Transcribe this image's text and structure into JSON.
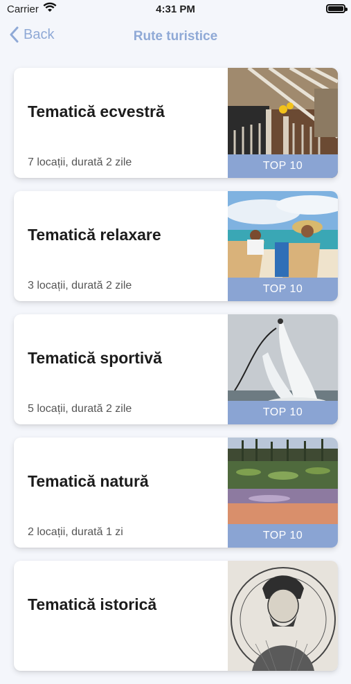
{
  "status": {
    "carrier": "Carrier",
    "time": "4:31 PM"
  },
  "nav": {
    "back_label": "Back",
    "title": "Rute turistice"
  },
  "routes": [
    {
      "title": "Tematică ecvestră",
      "subtitle": "7 locații, durată 2 zile",
      "badge": "TOP 10",
      "image": "stable-photo"
    },
    {
      "title": "Tematică relaxare",
      "subtitle": "3 locații, durată 2 zile",
      "badge": "TOP 10",
      "image": "beach-photo"
    },
    {
      "title": "Tematică sportivă",
      "subtitle": "5 locații, durată 2 zile",
      "badge": "TOP 10",
      "image": "flyboard-photo"
    },
    {
      "title": "Tematică natură",
      "subtitle": "2 locații, durată 1 zi",
      "badge": "TOP 10",
      "image": "lake-photo"
    },
    {
      "title": "Tematică istorică",
      "subtitle": "",
      "badge": "",
      "image": "portrait-engraving"
    }
  ],
  "colors": {
    "accent": "#8fa9d6",
    "badge": "#8aa4d3",
    "background": "#f4f6fb"
  }
}
